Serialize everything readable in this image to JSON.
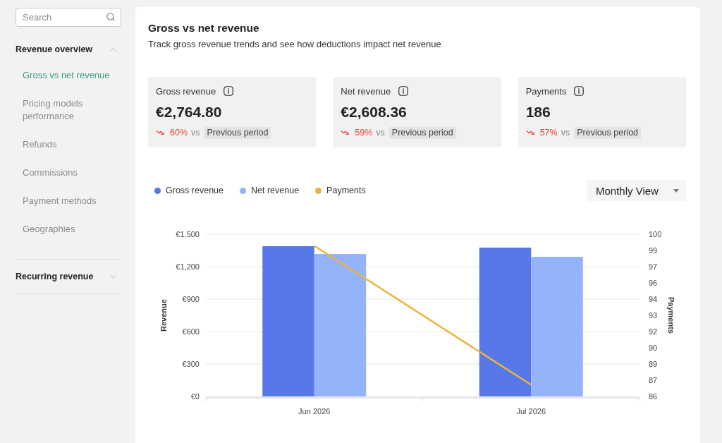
{
  "sidebar": {
    "search": {
      "placeholder": "Search"
    },
    "sections": [
      {
        "label": "Revenue overview",
        "expanded": true,
        "items": [
          {
            "label": "Gross vs net revenue",
            "selected": true
          },
          {
            "label": "Pricing models performance",
            "selected": false
          },
          {
            "label": "Refunds",
            "selected": false
          },
          {
            "label": "Commissions",
            "selected": false
          },
          {
            "label": "Payment methods",
            "selected": false
          },
          {
            "label": "Geographies",
            "selected": false
          }
        ]
      },
      {
        "label": "Recurring revenue",
        "expanded": false
      }
    ]
  },
  "main": {
    "title": "Gross vs net revenue",
    "subtitle": "Track gross revenue trends and see how deductions impact net revenue",
    "stats": [
      {
        "label": "Gross revenue",
        "value": "€2,764.80",
        "decreased": true,
        "change": "60%",
        "comparison": "vs",
        "period": "Previous period"
      },
      {
        "label": "Net revenue",
        "value": "€2,608.36",
        "decreased": true,
        "change": "59%",
        "comparison": "vs",
        "period": "Previous period"
      },
      {
        "label": "Payments",
        "value": "186",
        "decreased": true,
        "change": "57%",
        "comparison": "vs",
        "period": "Previous period"
      }
    ],
    "view_select": {
      "value": "Monthly View"
    },
    "chart_data": {
      "type": "bar",
      "stacked": false,
      "grid": true,
      "legend": "top",
      "ylabel": "Revenue",
      "y2label": "Payments",
      "categories": [
        "Jun 2026",
        "Jul 2026"
      ],
      "series": [
        {
          "name": "Gross revenue",
          "color": "#5778e8",
          "type": "bar",
          "values": [
            1389,
            1376
          ]
        },
        {
          "name": "Net revenue",
          "color": "#94b3fa",
          "type": "bar",
          "values": [
            1317,
            1291
          ]
        },
        {
          "name": "Payments",
          "color": "#ecb43c",
          "type": "line",
          "axis": "y2",
          "values": [
            99,
            87
          ]
        }
      ],
      "ylim": [
        0,
        1500
      ],
      "yticks": [
        {
          "value": 0,
          "label": "€0"
        },
        {
          "value": 300,
          "label": "€300"
        },
        {
          "value": 600,
          "label": "€600"
        },
        {
          "value": 900,
          "label": "€900"
        },
        {
          "value": 1200,
          "label": "€1,200"
        },
        {
          "value": 1500,
          "label": "€1,500"
        }
      ],
      "y2lim": [
        86,
        100
      ],
      "y2ticks": [
        {
          "value": 86,
          "label": "86"
        },
        {
          "value": 87.4,
          "label": "87"
        },
        {
          "value": 88.8,
          "label": "89"
        },
        {
          "value": 90.2,
          "label": "90"
        },
        {
          "value": 91.6,
          "label": "92"
        },
        {
          "value": 93,
          "label": "93"
        },
        {
          "value": 94.4,
          "label": "94"
        },
        {
          "value": 95.8,
          "label": "96"
        },
        {
          "value": 97.2,
          "label": "97"
        },
        {
          "value": 98.6,
          "label": "99"
        },
        {
          "value": 100,
          "label": "100"
        }
      ]
    }
  }
}
